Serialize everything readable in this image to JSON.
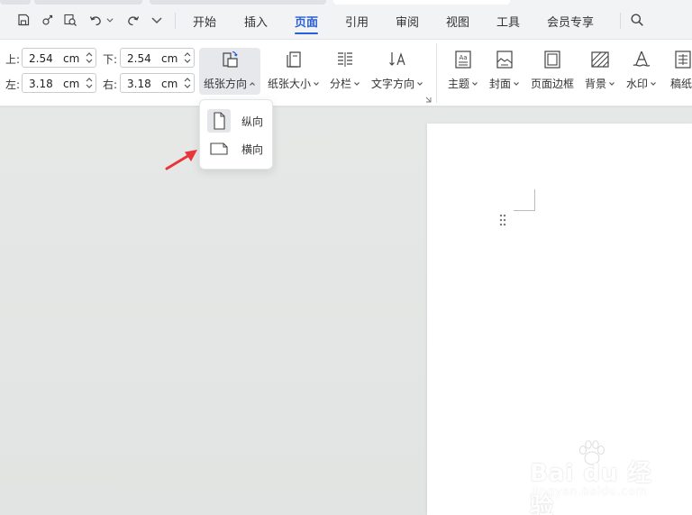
{
  "menu": {
    "tabs": [
      "开始",
      "插入",
      "页面",
      "引用",
      "审阅",
      "视图",
      "工具",
      "会员专享"
    ],
    "active_tab": "页面"
  },
  "quick_access": [
    "save-icon",
    "link-icon",
    "find-replace-icon",
    "undo-icon",
    "redo-icon",
    "more-icon"
  ],
  "ribbon": {
    "margins": {
      "top_label": "上:",
      "top_value": "2.54",
      "top_unit": "cm",
      "bottom_label": "下:",
      "bottom_value": "2.54",
      "bottom_unit": "cm",
      "left_label": "左:",
      "left_value": "3.18",
      "left_unit": "cm",
      "right_label": "右:",
      "right_value": "3.18",
      "right_unit": "cm"
    },
    "buttons": {
      "orientation": "纸张方向",
      "size": "纸张大小",
      "columns": "分栏",
      "text_direction": "文字方向",
      "theme": "主题",
      "cover": "封面",
      "page_border": "页面边框",
      "background": "背景",
      "watermark": "水印",
      "manuscript": "稿纸"
    }
  },
  "orientation_menu": {
    "portrait": "纵向",
    "landscape": "横向",
    "selected": "纵向"
  },
  "watermark_overlay": {
    "brand": "Bai du 经验",
    "url": "jingyan.baidu.com"
  },
  "colors": {
    "accent": "#2b5fd9",
    "arrow": "#e8343a",
    "menubar_bg": "#f2f3f5",
    "workspace_bg": "#e4e6e5"
  }
}
